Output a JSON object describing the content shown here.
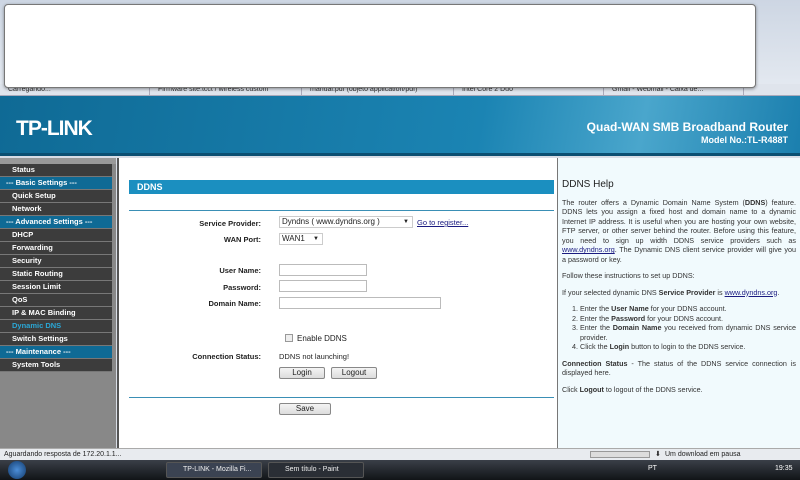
{
  "browser": {
    "tabs": [
      "Carregando...",
      "Firmware site:tcct / wireless custom",
      "manual.pdf (objeto application/pdf)",
      "Intel Core 2 Duo",
      "Gmail - Webmail - Caixa de..."
    ]
  },
  "header": {
    "logo": "TP-LINK",
    "product": "Quad-WAN SMB Broadband Router",
    "model": "Model No.:TL-R488T"
  },
  "sidebar": {
    "items": [
      {
        "label": "Status",
        "type": "item"
      },
      {
        "label": "--- Basic Settings ---",
        "type": "section"
      },
      {
        "label": "Quick Setup",
        "type": "item"
      },
      {
        "label": "Network",
        "type": "item"
      },
      {
        "label": "--- Advanced Settings ---",
        "type": "section"
      },
      {
        "label": "DHCP",
        "type": "item"
      },
      {
        "label": "Forwarding",
        "type": "item"
      },
      {
        "label": "Security",
        "type": "item"
      },
      {
        "label": "Static Routing",
        "type": "item"
      },
      {
        "label": "Session Limit",
        "type": "item"
      },
      {
        "label": "QoS",
        "type": "item"
      },
      {
        "label": "IP & MAC Binding",
        "type": "item"
      },
      {
        "label": "Dynamic DNS",
        "type": "active"
      },
      {
        "label": "Switch Settings",
        "type": "item"
      },
      {
        "label": "--- Maintenance ---",
        "type": "section"
      },
      {
        "label": "System Tools",
        "type": "item"
      }
    ]
  },
  "form": {
    "title": "DDNS",
    "service_provider_label": "Service Provider:",
    "service_provider_value": "Dyndns ( www.dyndns.org )",
    "register_link": "Go to register...",
    "wan_port_label": "WAN Port:",
    "wan_port_value": "WAN1",
    "username_label": "User Name:",
    "username_value": "",
    "password_label": "Password:",
    "password_value": "",
    "domain_label": "Domain Name:",
    "domain_value": "",
    "enable_label": "Enable DDNS",
    "enabled": false,
    "conn_status_label": "Connection Status:",
    "conn_status_value": "DDNS not launching!",
    "login": "Login",
    "logout": "Logout",
    "save": "Save"
  },
  "help": {
    "title": "DDNS Help",
    "p1a": "The router offers a Dynamic Domain Name System (",
    "p1b": "DDNS",
    "p1c": ") feature. DDNS lets you assign a fixed host and domain name to a dynamic Internet IP address. It is useful when you are hosting your own website, FTP server, or other server behind the router. Before using this feature, you need to sign up width DDNS service providers such as ",
    "p1link": "www.dyndns.org",
    "p1d": ". The Dynamic DNS client service provider will give you a password or key.",
    "p2": "Follow these instructions to set up DDNS:",
    "p3a": "If your selected dynamic DNS ",
    "p3b": "Service Provider",
    "p3c": " is ",
    "p3link": "www.dyndns.org",
    "s1a": "Enter the ",
    "s1b": "User Name",
    "s1c": " for your DDNS account.",
    "s2a": "Enter the ",
    "s2b": "Password",
    "s2c": " for your DDNS account.",
    "s3a": "Enter the ",
    "s3b": "Domain Name",
    "s3c": " you received from dynamic DNS service provider.",
    "s4a": "Click the ",
    "s4b": "Login",
    "s4c": " button to login to the DDNS service.",
    "p4a": "Connection Status",
    "p4b": " - The status of the DDNS service connection is displayed here.",
    "p5a": "Click ",
    "p5b": "Logout",
    "p5c": " to logout of the DDNS service."
  },
  "statusbar": {
    "text": "Aguardando resposta de 172.20.1.1...",
    "download": "Um download em pausa"
  },
  "taskbar": {
    "tasks": [
      "TP-LINK - Mozilla Fi...",
      "Sem título - Paint"
    ],
    "lang": "PT",
    "clock": "19:35"
  }
}
